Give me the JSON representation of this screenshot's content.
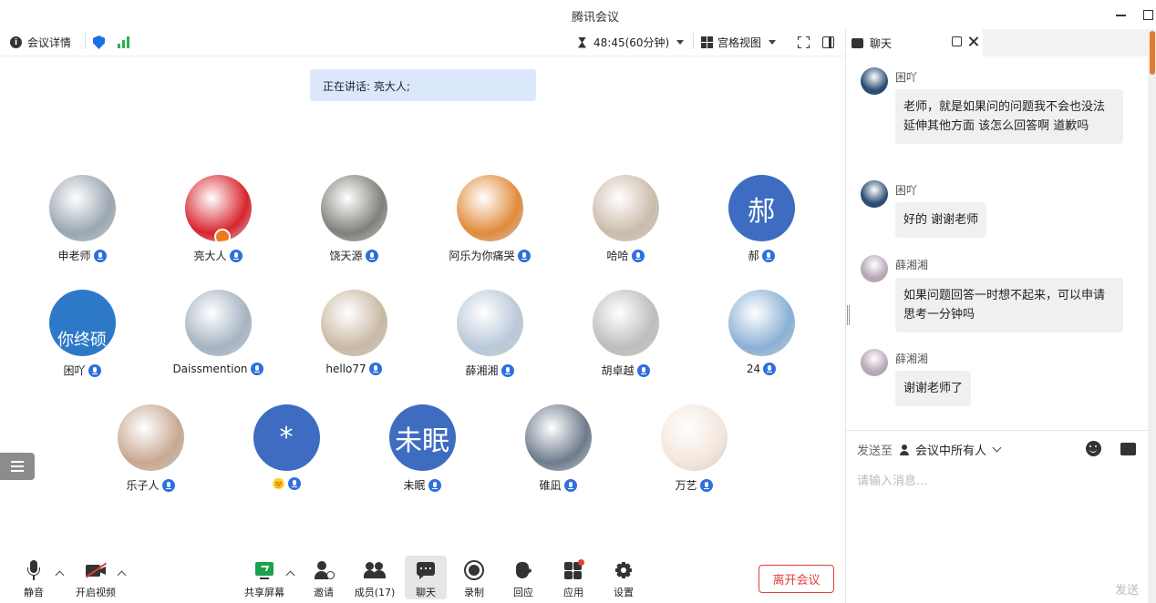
{
  "window": {
    "title": "腾讯会议"
  },
  "meetbar": {
    "details": "会议详情",
    "timer": "48:45(60分钟)",
    "view_mode": "宫格视图"
  },
  "stage": {
    "speaking": "正在讲话: 亮大人;",
    "participants": [
      {
        "name": "申老师",
        "avatar_color": "#9aa6b1",
        "avatar_text": ""
      },
      {
        "name": "亮大人",
        "avatar_color": "#d8242e",
        "avatar_text": ""
      },
      {
        "name": "饶天源",
        "avatar_color": "#7d8178",
        "avatar_text": ""
      },
      {
        "name": "阿乐为你痛哭",
        "avatar_color": "#e18b3a",
        "avatar_text": ""
      },
      {
        "name": "哈哈",
        "avatar_color": "#cbbcaa",
        "avatar_text": ""
      },
      {
        "name": "郝",
        "avatar_color": "#3e6cc1",
        "avatar_text": "郝"
      },
      {
        "name": "困吖",
        "avatar_color": "#2d79c8",
        "avatar_text": "你终硕"
      },
      {
        "name": "Daissmention",
        "avatar_color": "#a6b3c2",
        "avatar_text": ""
      },
      {
        "name": "hello77",
        "avatar_color": "#c9b9a4",
        "avatar_text": ""
      },
      {
        "name": "薛湘湘",
        "avatar_color": "#b9c9d9",
        "avatar_text": ""
      },
      {
        "name": "胡卓越",
        "avatar_color": "#bdbdbd",
        "avatar_text": ""
      },
      {
        "name": "24",
        "avatar_color": "#8ab0d6",
        "avatar_text": ""
      },
      {
        "name": "乐子人",
        "avatar_color": "#c8a890",
        "avatar_text": ""
      },
      {
        "name": "🌞",
        "avatar_color": "#3e6cc1",
        "avatar_text": "*"
      },
      {
        "name": "未眠",
        "avatar_color": "#3e6cc1",
        "avatar_text": "未眠"
      },
      {
        "name": "碓凪",
        "avatar_color": "#6d7b8c",
        "avatar_text": ""
      },
      {
        "name": "万艺",
        "avatar_color": "#f4e6dc",
        "avatar_text": ""
      }
    ]
  },
  "toolbar": {
    "mute": "静音",
    "video": "开启视频",
    "share": "共享屏幕",
    "invite": "邀请",
    "members": "成员(17)",
    "chat": "聊天",
    "record": "录制",
    "react": "回应",
    "apps": "应用",
    "settings": "设置",
    "leave": "离开会议"
  },
  "colors": {
    "accent": "#2e6fe0",
    "leave": "#e0403a",
    "speaking_bg": "#dbe8fb",
    "share_green": "#1aa34a"
  },
  "chat": {
    "tab": "聊天",
    "messages": [
      {
        "sender": "困吖",
        "text": "老师，就是如果问的问题我不会也没法延伸其他方面 该怎么回答啊   道歉吗"
      },
      {
        "sender": "困吖",
        "text": "好的  谢谢老师"
      },
      {
        "sender": "薛湘湘",
        "text": "如果问题回答一时想不起来，可以申请思考一分钟吗"
      },
      {
        "sender": "薛湘湘",
        "text": "谢谢老师了"
      }
    ],
    "send_to_label": "发送至",
    "send_to_target": "会议中所有人",
    "input_placeholder": "请输入消息...",
    "send": "发送"
  }
}
